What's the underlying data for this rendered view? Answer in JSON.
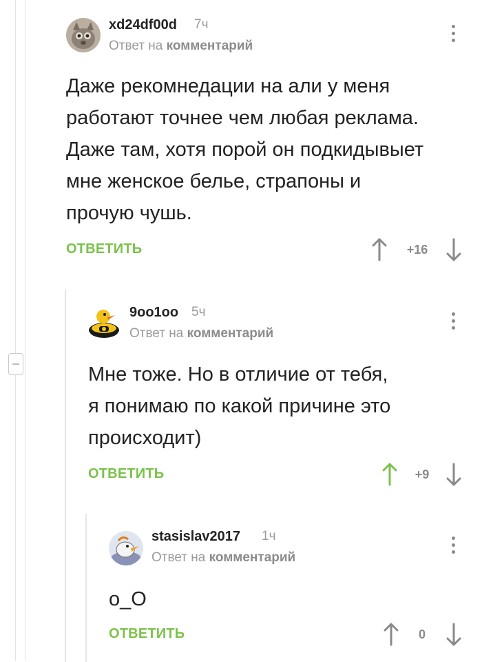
{
  "comments": [
    {
      "author": "xd24df00d",
      "time": "7ч",
      "reply_prefix": "Ответ на",
      "reply_target": "комментарий",
      "text_lines": [
        "Даже рекомнедации на али у меня",
        "работают точнее чем любая реклама.",
        "Даже там, хотя порой он подкидывыет",
        "мне женское белье, страпоны и",
        "прочую чушь."
      ],
      "reply_label": "ОТВЕТИТЬ",
      "rating": "+16",
      "upvoted": false
    },
    {
      "author": "9oo1oo",
      "time": "5ч",
      "reply_prefix": "Ответ на",
      "reply_target": "комментарий",
      "text_lines": [
        "Мне тоже. Но в отличие от тебя,",
        "я понимаю по какой причине это",
        "происходит)"
      ],
      "reply_label": "ОТВЕТИТЬ",
      "rating": "+9",
      "upvoted": true
    },
    {
      "author": "stasislav2017",
      "time": "1ч",
      "reply_prefix": "Ответ на",
      "reply_target": "комментарий",
      "text_lines": [
        "o_O"
      ],
      "reply_label": "ОТВЕТИТЬ",
      "rating": "0",
      "upvoted": false
    }
  ],
  "colors": {
    "accent_green": "#7bc24a",
    "muted_gray": "#9b9b9b",
    "text": "#222222"
  },
  "icons": [
    "avatar-cat-photo",
    "avatar-duck-cartoon",
    "avatar-bird-cartoon",
    "kebab-menu-icon",
    "arrow-up-icon",
    "arrow-down-icon",
    "collapse-minus-icon"
  ]
}
